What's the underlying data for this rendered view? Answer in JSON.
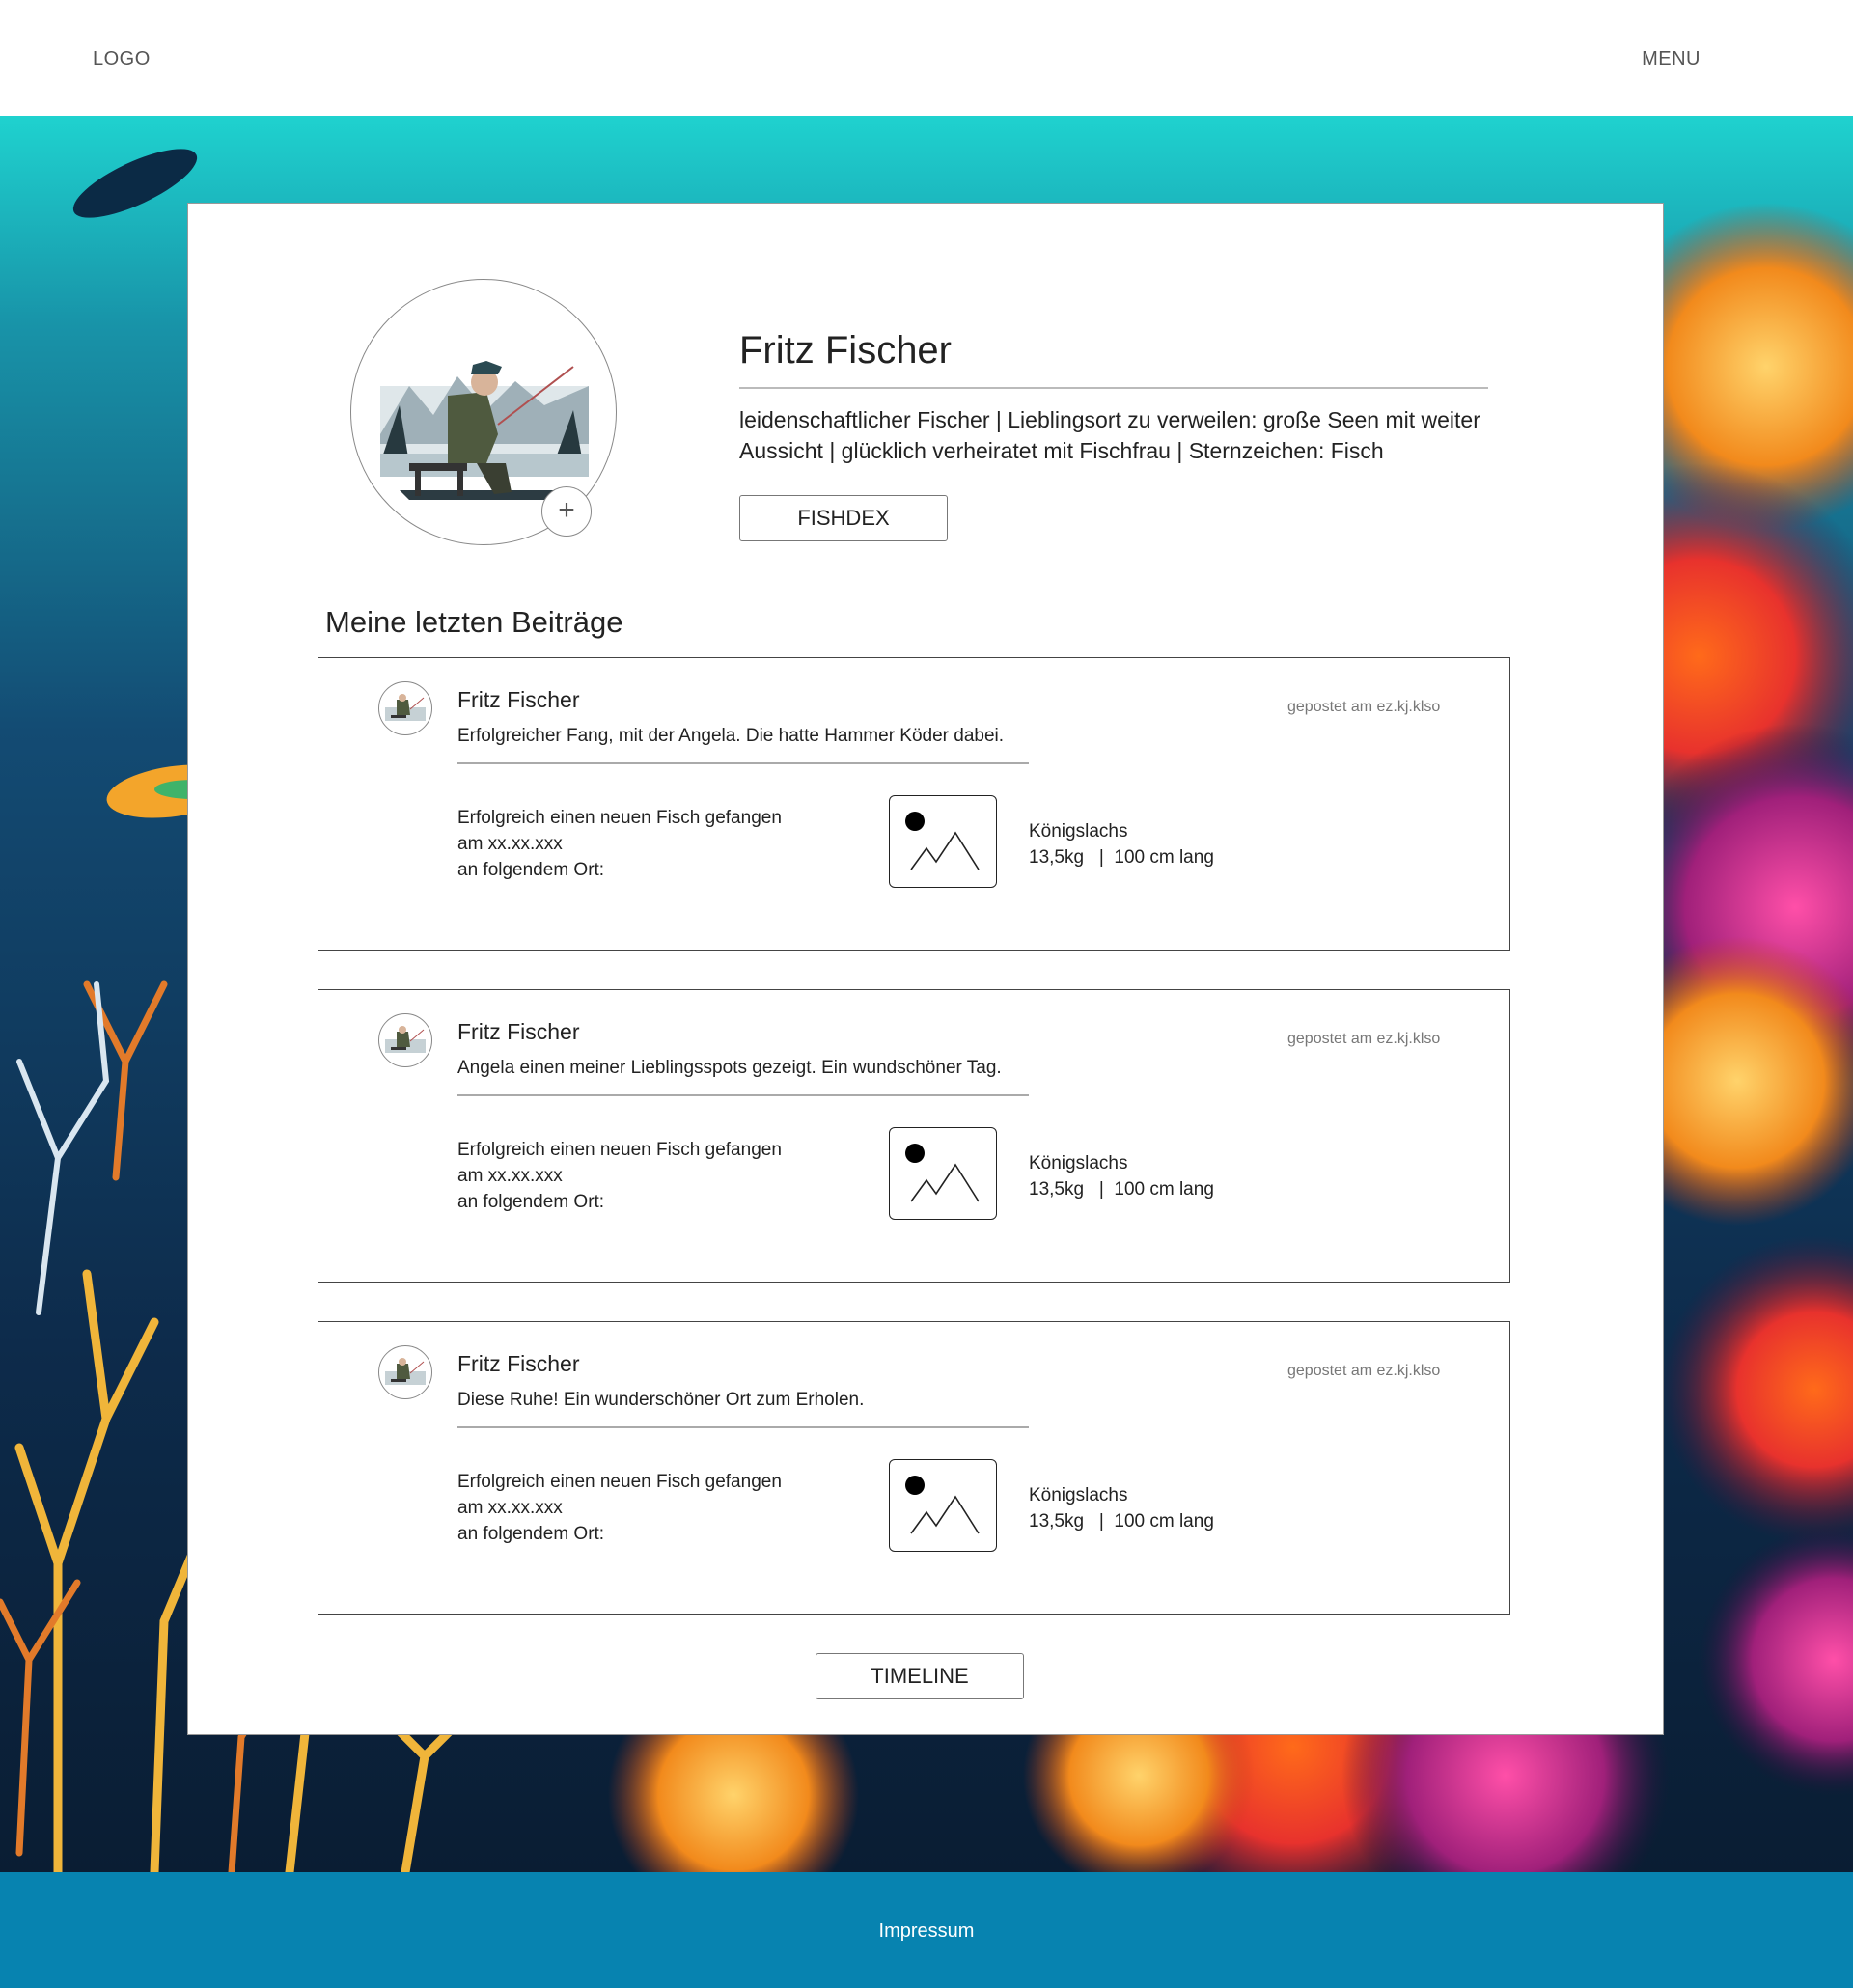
{
  "header": {
    "logo": "LOGO",
    "menu": "MENU"
  },
  "profile": {
    "name": "Fritz Fischer",
    "bio": "leidenschaftlicher Fischer | Lieblingsort zu verweilen: große Seen mit weiter Aussicht | glücklich verheiratet mit Fischfrau | Sternzeichen: Fisch",
    "add_icon": "plus-icon",
    "fishdex_label": "FISHDEX"
  },
  "posts_section": {
    "title": "Meine letzten Beiträge",
    "posts": [
      {
        "author": "Fritz Fischer",
        "text": "Erfolgreicher Fang, mit der Angela. Die hatte Hammer Köder dabei.",
        "date": "gepostet am ez.kj.klso",
        "desc_line1": "Erfolgreich einen neuen Fisch gefangen",
        "desc_line2": "am xx.xx.xxx",
        "desc_line3": "an folgendem Ort:",
        "fish_name": "Königslachs",
        "fish_stats": "13,5kg   |  100 cm lang"
      },
      {
        "author": "Fritz Fischer",
        "text": "Angela einen meiner Lieblingsspots gezeigt. Ein wundschöner Tag.",
        "date": "gepostet am ez.kj.klso",
        "desc_line1": "Erfolgreich einen neuen Fisch gefangen",
        "desc_line2": "am xx.xx.xxx",
        "desc_line3": "an folgendem Ort:",
        "fish_name": "Königslachs",
        "fish_stats": "13,5kg   |  100 cm lang"
      },
      {
        "author": "Fritz Fischer",
        "text": "Diese Ruhe! Ein wunderschöner Ort zum Erholen.",
        "date": "gepostet am ez.kj.klso",
        "desc_line1": "Erfolgreich einen neuen Fisch gefangen",
        "desc_line2": "am xx.xx.xxx",
        "desc_line3": "an folgendem Ort:",
        "fish_name": "Königslachs",
        "fish_stats": "13,5kg   |  100 cm lang"
      }
    ]
  },
  "timeline_label": "TIMELINE",
  "footer": {
    "impressum": "Impressum"
  },
  "colors": {
    "footer": "#0783b0",
    "card_border": "#444444"
  }
}
